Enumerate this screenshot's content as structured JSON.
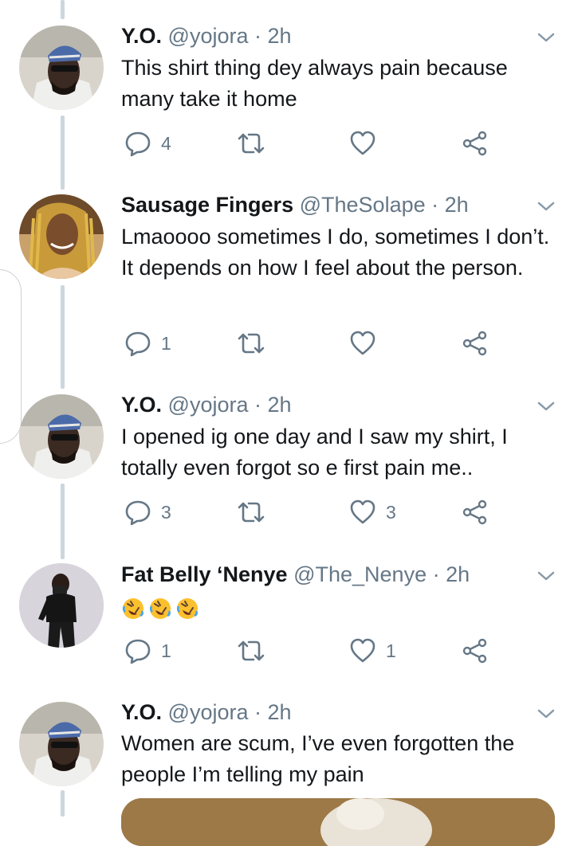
{
  "tweets": [
    {
      "name": "Y.O.",
      "handle": "@yojora",
      "separator": "·",
      "time": "2h",
      "text": "This shirt thing dey always pain because many take it home",
      "replies": "4",
      "retweets": "",
      "likes": ""
    },
    {
      "name": "Sausage Fingers",
      "handle": "@TheSolape",
      "separator": "·",
      "time": "2h",
      "text": "Lmaoooo sometimes I do, sometimes I don’t. It depends on how I feel about the person.",
      "replies": "1",
      "retweets": "",
      "likes": ""
    },
    {
      "name": "Y.O.",
      "handle": "@yojora",
      "separator": "·",
      "time": "2h",
      "text": "I opened ig one day and I saw my shirt, I totally even forgot so e first pain me..",
      "replies": "3",
      "retweets": "",
      "likes": "3"
    },
    {
      "name": "Fat Belly ‘Nenye",
      "handle": "@The_Nenye",
      "separator": "·",
      "time": "2h",
      "text": "",
      "emoji": [
        "rolling-on-floor-laughing",
        "rolling-on-floor-laughing",
        "rolling-on-floor-laughing"
      ],
      "replies": "1",
      "retweets": "",
      "likes": "1"
    },
    {
      "name": "Y.O.",
      "handle": "@yojora",
      "separator": "·",
      "time": "2h",
      "text": "Women are scum, I’ve even forgotten the people I’m telling my pain"
    }
  ],
  "icons": {
    "reply": "reply-icon",
    "retweet": "retweet-icon",
    "like": "heart-icon",
    "share": "share-icon",
    "more": "chevron-down-icon"
  },
  "colors": {
    "text": "#14171a",
    "secondary": "#657786",
    "thread_line": "#ccd6dd",
    "emoji_face": "#fbc02d"
  }
}
